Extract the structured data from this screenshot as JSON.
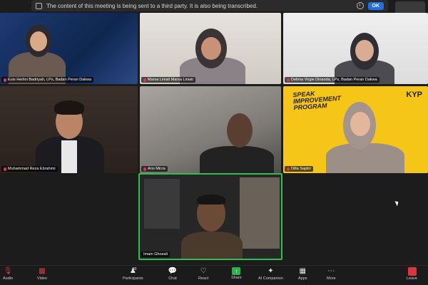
{
  "banner": {
    "text": "The content of this meeting is being sent to a third party. It is also being transcribed.",
    "info_icon": "i",
    "ok_label": "OK"
  },
  "participants": [
    {
      "name": "Euis Herlini Badriyah, LPs, Badan Peran Dakwa",
      "muted": true
    },
    {
      "name": "Marsa Liniati Marsa Liniati",
      "muted": true
    },
    {
      "name": "Delima Virgie Dinanda, LPs, Badan Peran Dakwa",
      "muted": true
    },
    {
      "name": "Muhammad Reza Ebrahimi",
      "muted": true
    },
    {
      "name": "Ario Mirza",
      "muted": true
    },
    {
      "name": "Dilla Sapitri",
      "muted": true
    },
    {
      "name": "Imam Ghozali",
      "muted": false
    }
  ],
  "tile6": {
    "brand_line1": "SPEAK",
    "brand_line2": "IMPROVEMENT",
    "brand_line3": "PROGRAM",
    "logo": "KYP"
  },
  "toolbar": {
    "audio": "Audio",
    "video": "Video",
    "participants": "Participants",
    "participants_count": "89",
    "chat": "Chat",
    "react": "React",
    "share": "Share",
    "ai_companion": "AI Companion",
    "apps": "Apps",
    "more": "More",
    "leave": "Leave"
  },
  "colors": {
    "accent": "#1f6fe5",
    "active_speaker": "#2fbf4b",
    "muted": "#e0383e",
    "brand_yellow": "#f5c518"
  }
}
